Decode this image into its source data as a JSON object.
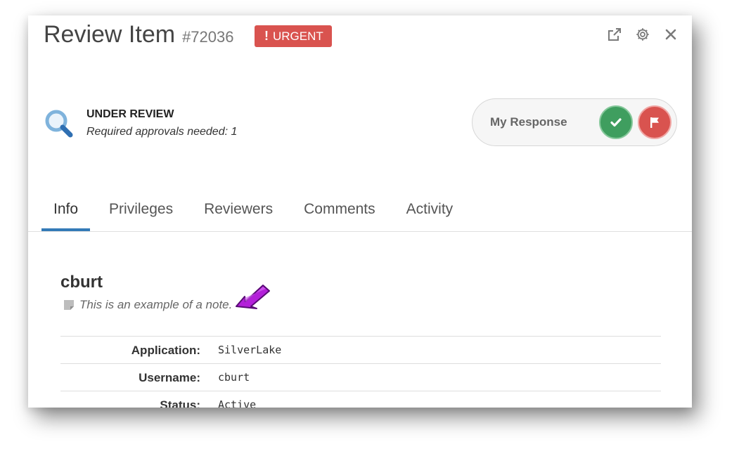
{
  "header": {
    "title": "Review Item",
    "item_id": "#72036",
    "badge": {
      "label": "URGENT",
      "color": "#d9534f"
    },
    "icons": [
      "external-link-icon",
      "gear-icon",
      "close-icon"
    ]
  },
  "status": {
    "title": "UNDER REVIEW",
    "subtitle": "Required approvals needed: 1",
    "icon": "magnifier-icon"
  },
  "response": {
    "label": "My Response",
    "approve_color": "#3f9e5f",
    "flag_color": "#d9534f"
  },
  "tabs": [
    {
      "label": "Info",
      "active": true
    },
    {
      "label": "Privileges",
      "active": false
    },
    {
      "label": "Reviewers",
      "active": false
    },
    {
      "label": "Comments",
      "active": false
    },
    {
      "label": "Activity",
      "active": false
    }
  ],
  "accent_color": "#337ab7",
  "user": {
    "name": "cburt",
    "note": "This is an example of a note."
  },
  "details": [
    {
      "label": "Application:",
      "value": "SilverLake"
    },
    {
      "label": "Username:",
      "value": "cburt"
    },
    {
      "label": "Status:",
      "value": "Active"
    }
  ]
}
